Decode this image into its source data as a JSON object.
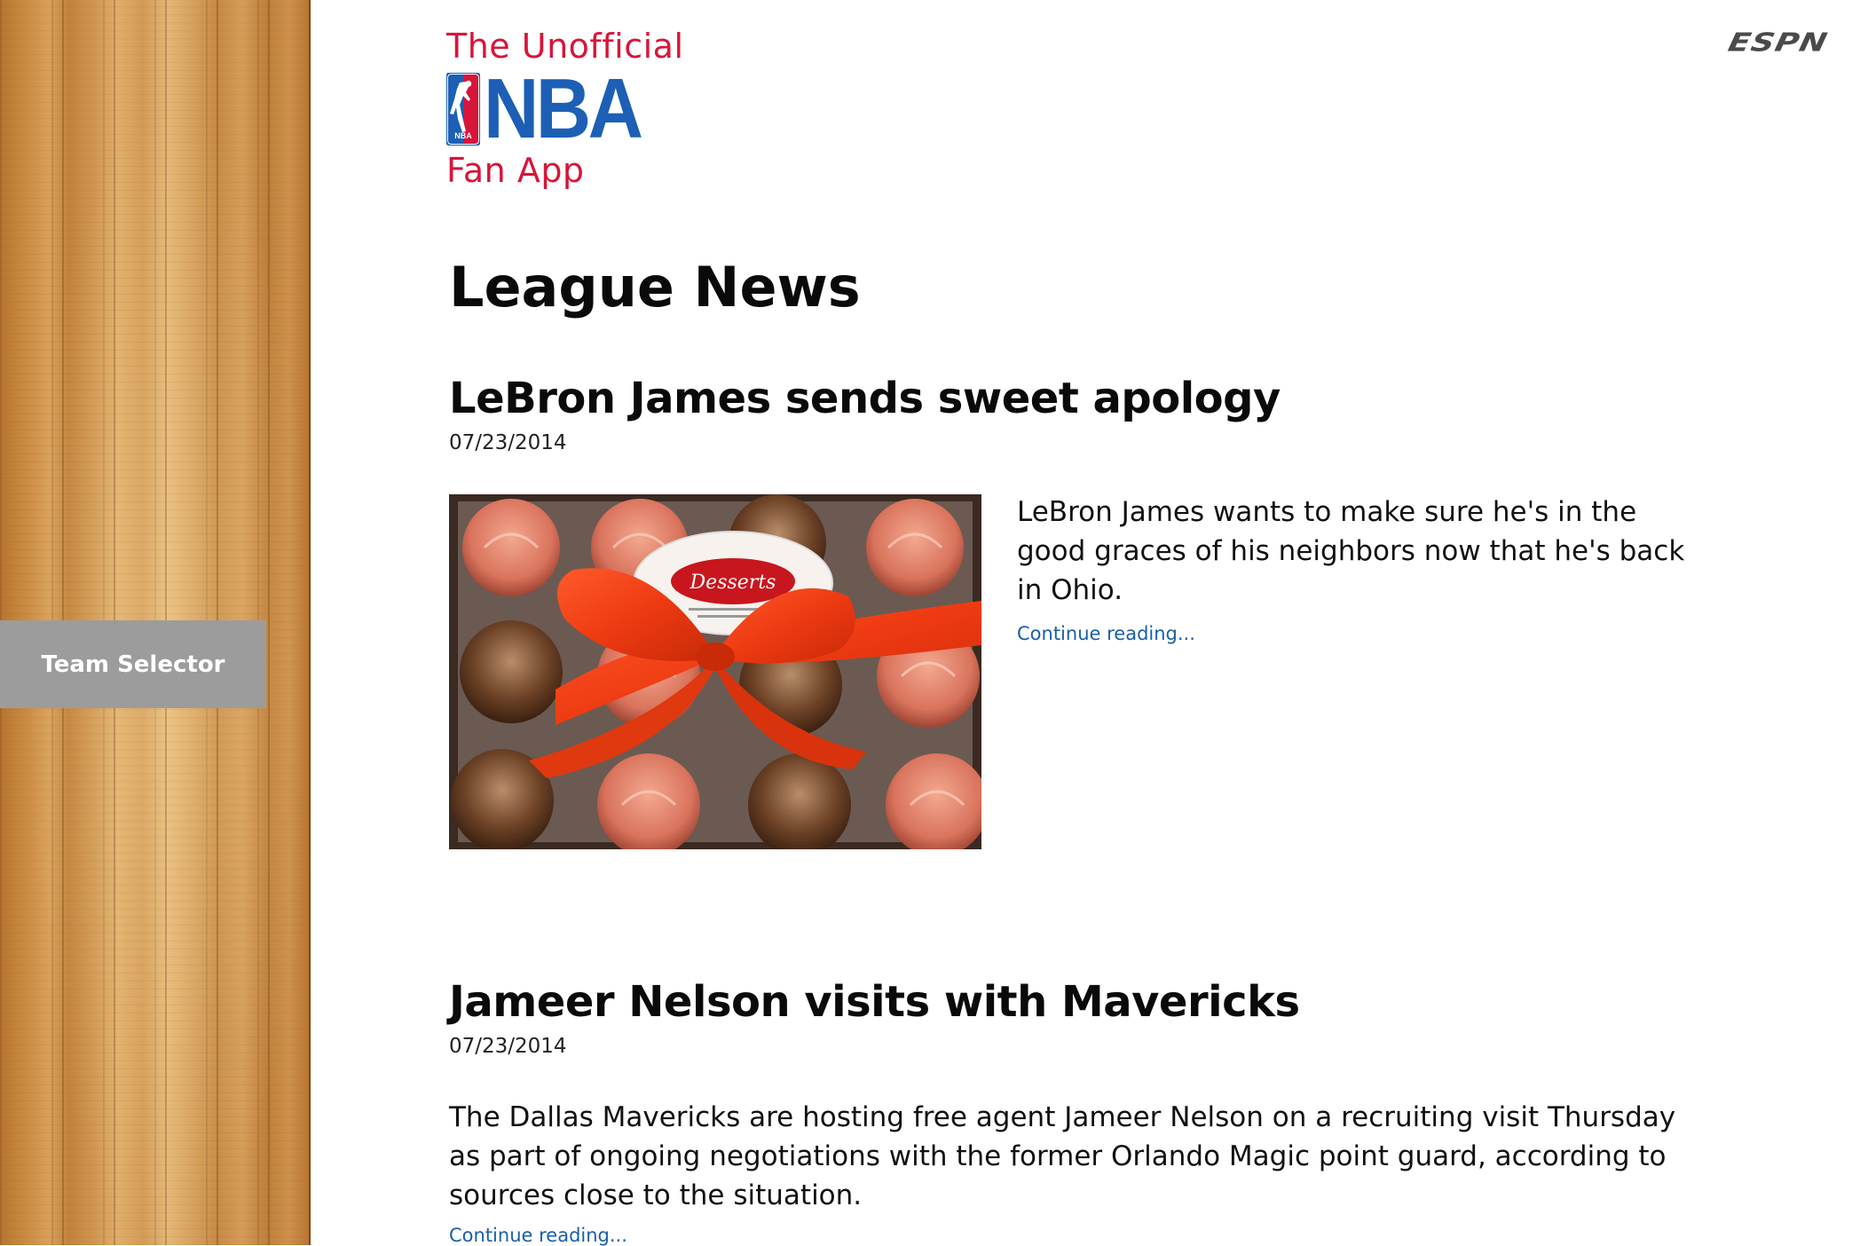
{
  "sidebar": {
    "team_selector_label": "Team Selector"
  },
  "brand": {
    "line1": "The Unofficial",
    "logo_text": "NBA",
    "line2": "Fan App",
    "accent_color": "#d6163a",
    "nba_blue": "#1d5fb5"
  },
  "header": {
    "espn_logo_text": "ESPN"
  },
  "main": {
    "section_title": "League News",
    "articles": [
      {
        "title": "LeBron James sends sweet apology",
        "date": "07/23/2014",
        "summary": "LeBron James wants to make sure he's in the good graces of his neighbors now that he's back in Ohio.",
        "continue_label": "Continue reading...",
        "image_label": "Desserts"
      },
      {
        "title": "Jameer Nelson visits with Mavericks",
        "date": "07/23/2014",
        "summary": "The Dallas Mavericks are hosting free agent Jameer Nelson on a recruiting visit Thursday as part of ongoing negotiations with the former Orlando Magic point guard, according to sources close to the situation.",
        "continue_label": "Continue reading..."
      }
    ]
  }
}
